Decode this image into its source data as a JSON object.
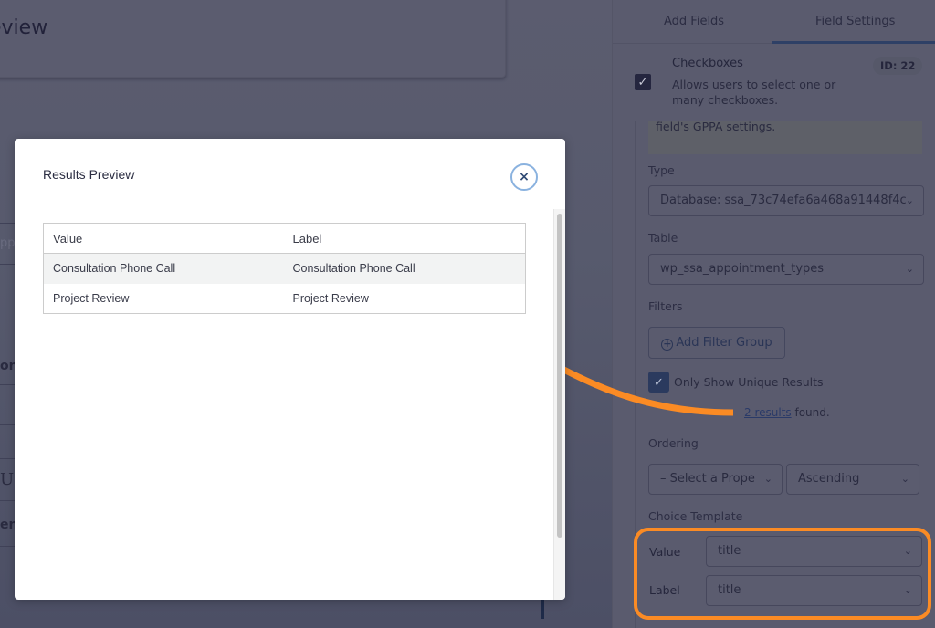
{
  "background": {
    "page_title_fragment": "eview",
    "left_fragments": [
      "pp",
      "on",
      "U",
      "en"
    ]
  },
  "sidebar": {
    "tabs": [
      {
        "label": "Add Fields",
        "active": false
      },
      {
        "label": "Field Settings",
        "active": true
      }
    ],
    "field": {
      "title": "Checkboxes",
      "description": "Allows users to select one or many checkboxes.",
      "id_badge": "ID: 22",
      "checked": true
    },
    "notice_text": "field's GPPA settings.",
    "type": {
      "label": "Type",
      "value": "Database: ssa_73c74efa6a468a91448f4c"
    },
    "table": {
      "label": "Table",
      "value": "wp_ssa_appointment_types"
    },
    "filters": {
      "label": "Filters",
      "add_button": "Add Filter Group"
    },
    "unique_results": {
      "label": "Only Show Unique Results",
      "checked": true
    },
    "results_found": {
      "link": "2 results",
      "suffix": " found."
    },
    "ordering": {
      "label": "Ordering",
      "property_value": "– Select a Prope",
      "direction_value": "Ascending"
    },
    "choice_template": {
      "label": "Choice Template",
      "value_label": "Value",
      "value_value": "title",
      "label_label": "Label",
      "label_value": "title"
    }
  },
  "modal": {
    "title": "Results Preview",
    "close_symbol": "×",
    "columns": [
      "Value",
      "Label"
    ],
    "rows": [
      {
        "value": "Consultation Phone Call",
        "label": "Consultation Phone Call"
      },
      {
        "value": "Project Review",
        "label": "Project Review"
      }
    ]
  },
  "annotation": {
    "color": "#fb8b24"
  },
  "icons": {
    "check": "✓",
    "chevron_down": "⌵",
    "plus_circle": "+"
  }
}
